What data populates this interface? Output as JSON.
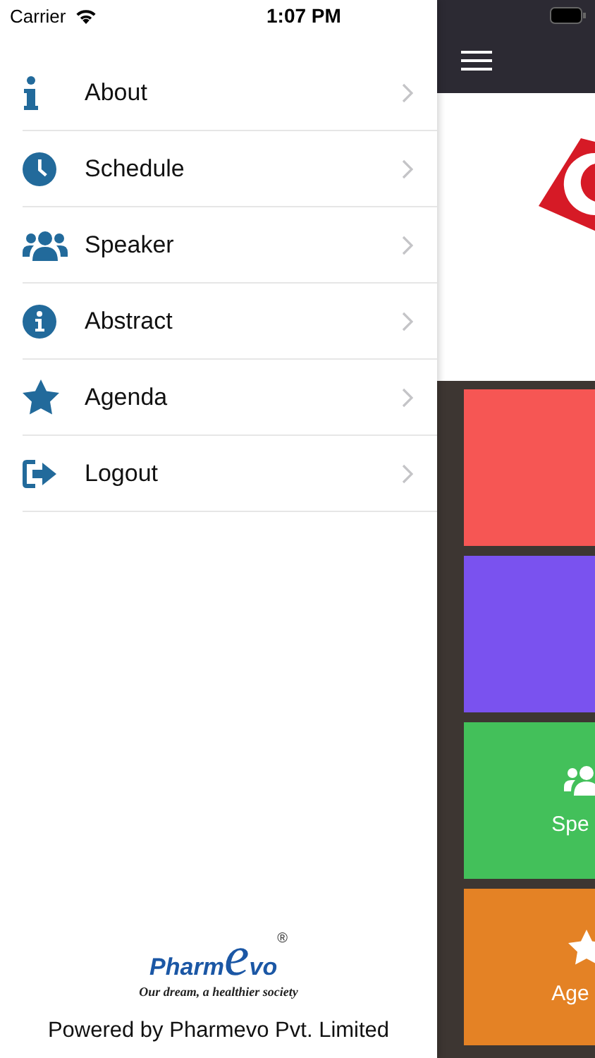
{
  "status_bar": {
    "carrier": "Carrier",
    "time": "1:07 PM"
  },
  "menu": [
    {
      "kind": "info",
      "label": "About"
    },
    {
      "kind": "clock",
      "label": "Schedule"
    },
    {
      "kind": "users",
      "label": "Speaker"
    },
    {
      "kind": "info-circle",
      "label": "Abstract"
    },
    {
      "kind": "star",
      "label": "Agenda"
    },
    {
      "kind": "logout",
      "label": "Logout"
    }
  ],
  "footer": {
    "logo_start": "Pharm",
    "logo_e": "e",
    "logo_end": "vo",
    "registered": "®",
    "tagline": "Our dream, a healthier society",
    "powered_by": "Powered by Pharmevo Pvt. Limited"
  },
  "background_tiles": [
    {
      "color": "#f65654",
      "kind": "plain"
    },
    {
      "color": "#7a52ef",
      "kind": "plain"
    },
    {
      "color": "#43c05a",
      "kind": "users",
      "label": "Spe"
    },
    {
      "color": "#e48225",
      "kind": "star",
      "label": "Age"
    }
  ]
}
